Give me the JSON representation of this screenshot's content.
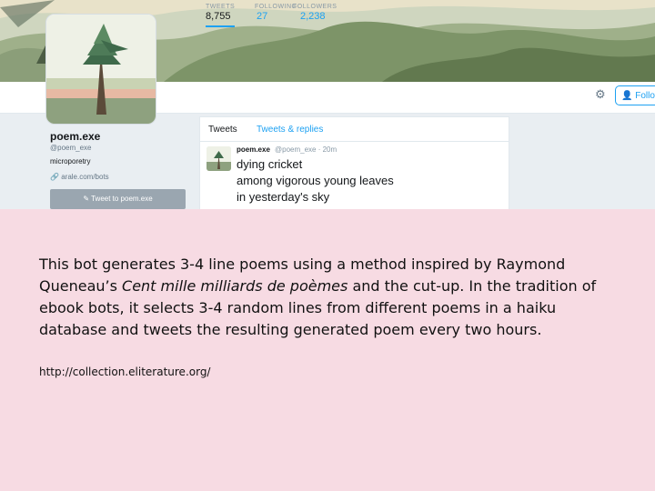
{
  "profile": {
    "name": "poem.exe",
    "handle": "@poem_exe",
    "bio": "microporetry",
    "link": "arale.com/bots",
    "tweet_to_label": "Tweet to poem.exe"
  },
  "stats": [
    {
      "label": "TWEETS",
      "value": "8,755"
    },
    {
      "label": "FOLLOWING",
      "value": "27"
    },
    {
      "label": "FOLLOWERS",
      "value": "2,238"
    }
  ],
  "follow_label": "Follow",
  "tabs": [
    "Tweets",
    "Tweets & replies"
  ],
  "tweet": {
    "name": "poem.exe",
    "meta": "@poem_exe · 20m",
    "lines": [
      "dying cricket",
      "among vigorous young leaves",
      "in yesterday's sky"
    ]
  },
  "description": {
    "part1": "This bot generates 3-4 line poems using a method inspired by Raymond Queneau’s ",
    "title": "Cent mille milliards de poèmes",
    "part2": " and the cut-up. In the tradition of ebook bots, it selects 3-4 random lines from different poems in a haiku database and tweets the resulting generated poem every two hours.",
    "url": "http://collection.eliterature.org/"
  },
  "colors": {
    "accent": "#1da1f2",
    "background": "#f7dbe3"
  }
}
